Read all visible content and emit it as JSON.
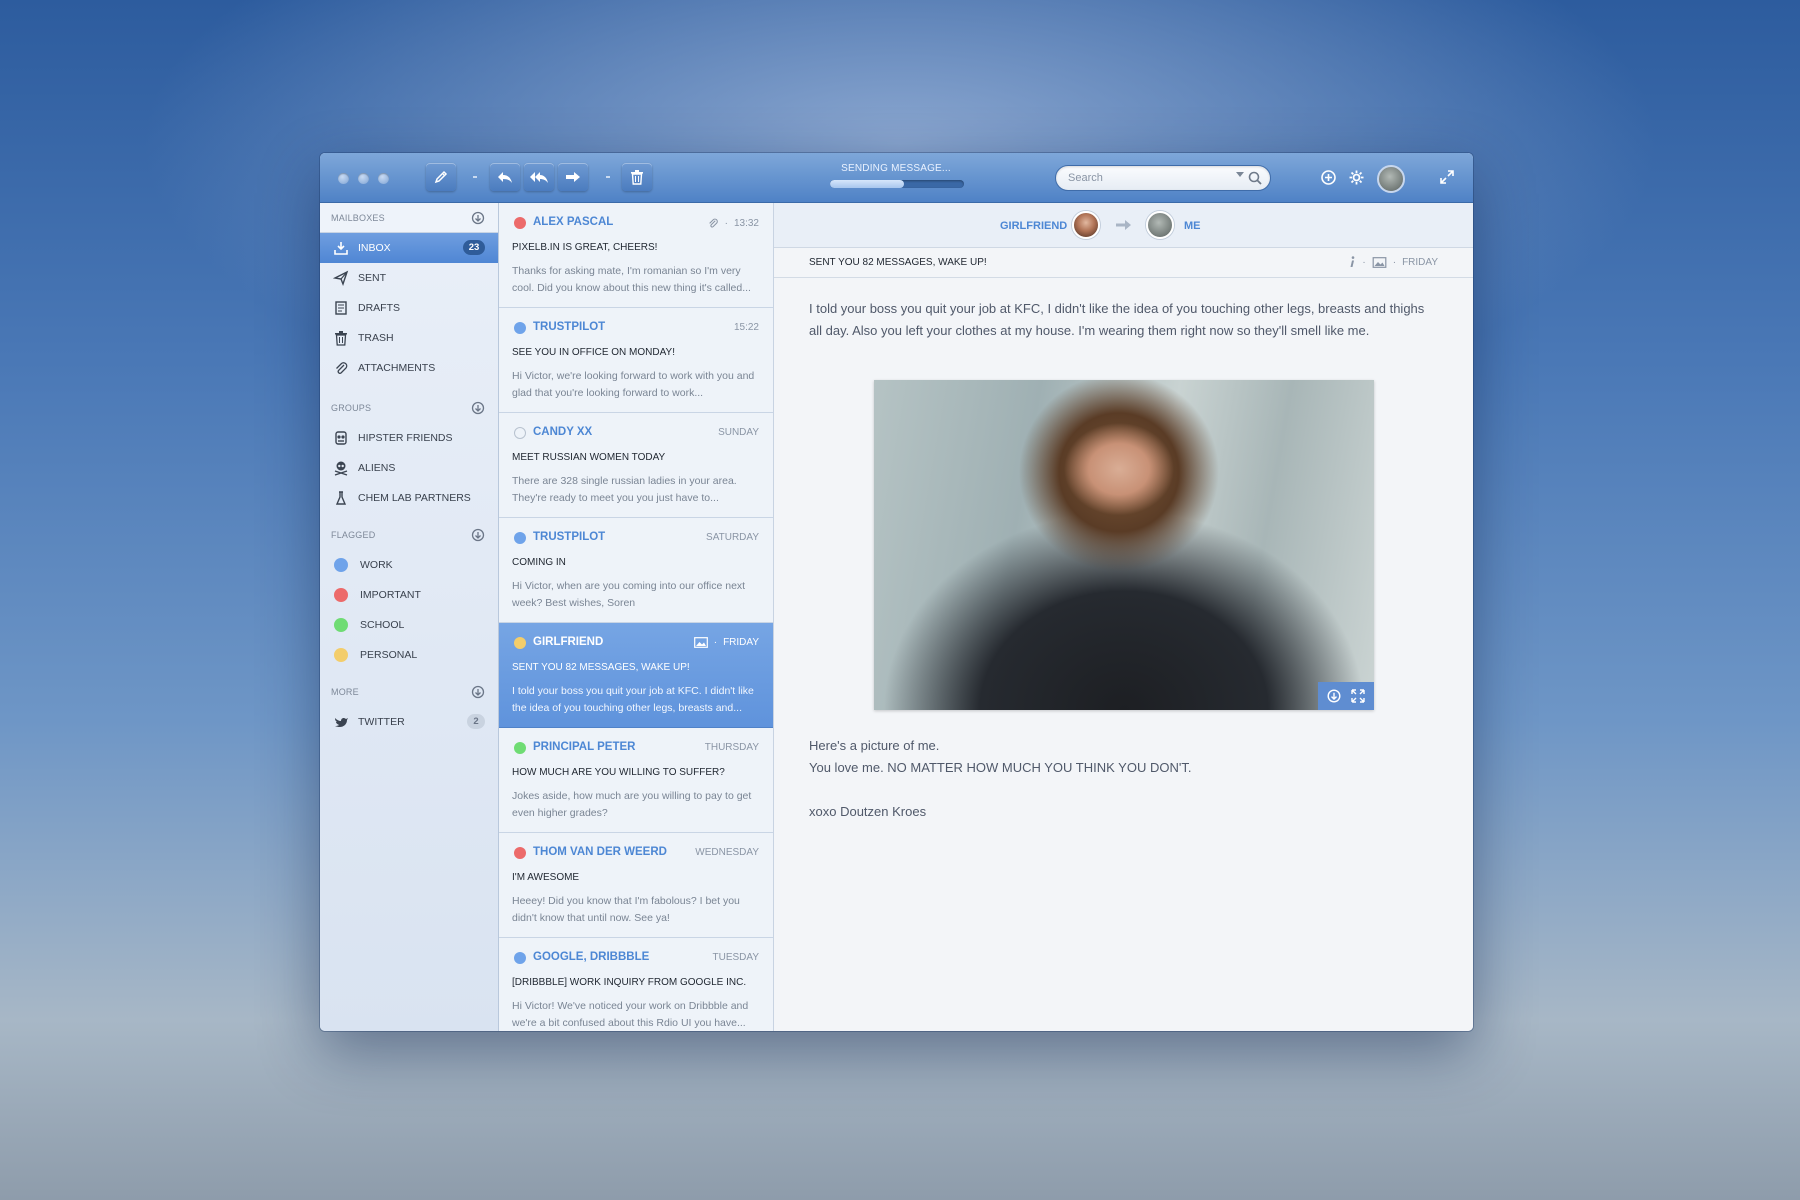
{
  "toolbar": {
    "status": "SENDING MESSAGE...",
    "progress": 0.55,
    "search_placeholder": "Search"
  },
  "sidebar": {
    "mailboxes_label": "MAILBOXES",
    "mailboxes": [
      {
        "label": "INBOX",
        "icon": "inbox-icon",
        "badge": "23",
        "active": true
      },
      {
        "label": "SENT",
        "icon": "paper-plane-icon"
      },
      {
        "label": "DRAFTS",
        "icon": "drafts-icon"
      },
      {
        "label": "TRASH",
        "icon": "trash-icon"
      },
      {
        "label": "ATTACHMENTS",
        "icon": "paperclip-icon"
      }
    ],
    "groups_label": "GROUPS",
    "groups": [
      {
        "label": "HIPSTER FRIENDS",
        "icon": "hipster-icon"
      },
      {
        "label": "ALIENS",
        "icon": "skull-icon"
      },
      {
        "label": "CHEM LAB PARTNERS",
        "icon": "flask-icon"
      }
    ],
    "flagged_label": "FLAGGED",
    "flagged": [
      {
        "label": "WORK",
        "color": "#6fa3ea"
      },
      {
        "label": "IMPORTANT",
        "color": "#ec6a6a"
      },
      {
        "label": "SCHOOL",
        "color": "#6fdc74"
      },
      {
        "label": "PERSONAL",
        "color": "#f3cd6b"
      }
    ],
    "more_label": "MORE",
    "more": [
      {
        "label": "TWITTER",
        "icon": "twitter-icon",
        "badge": "2"
      }
    ]
  },
  "messages": [
    {
      "sender": "ALEX PASCAL",
      "time": "13:32",
      "dot": "#ec6a6a",
      "attachment": true,
      "subject": "PIXELB.IN IS GREAT, CHEERS!",
      "preview": "Thanks for asking mate, I'm romanian so I'm very cool. Did you know about this new thing it's called..."
    },
    {
      "sender": "TRUSTPILOT",
      "time": "15:22",
      "dot": "#6fa3ea",
      "subject": "SEE YOU IN OFFICE ON MONDAY!",
      "preview": "Hi Victor, we're looking forward to work with you and glad that you're looking forward to work..."
    },
    {
      "sender": "CANDY XX",
      "time": "SUNDAY",
      "dot": "",
      "subject": "MEET RUSSIAN WOMEN TODAY",
      "preview": "There are 328 single russian ladies in your area. They're ready to meet you you just have to..."
    },
    {
      "sender": "TRUSTPILOT",
      "time": "SATURDAY",
      "dot": "#6fa3ea",
      "subject": "COMING IN",
      "preview": "Hi Victor, when are you coming into our office next week? Best wishes, Soren"
    },
    {
      "sender": "GIRLFRIEND",
      "time": "FRIDAY",
      "dot": "#f3cd6b",
      "image": true,
      "selected": true,
      "subject": "SENT YOU 82 MESSAGES, WAKE UP!",
      "preview": "I told your boss you quit your job at KFC. I didn't like the idea of you touching other legs, breasts and..."
    },
    {
      "sender": "PRINCIPAL PETER",
      "time": "THURSDAY",
      "dot": "#6fdc74",
      "subject": "HOW MUCH ARE YOU WILLING TO SUFFER?",
      "preview": "Jokes aside, how much are you willing to pay to get even higher grades?"
    },
    {
      "sender": "THOM VAN DER WEERD",
      "time": "WEDNESDAY",
      "dot": "#ec6a6a",
      "subject": "I'M AWESOME",
      "preview": "Heeey! Did you know that I'm fabolous? I bet you didn't know that until now. See ya!"
    },
    {
      "sender": "GOOGLE, DRIBBBLE",
      "time": "TUESDAY",
      "dot": "#6fa3ea",
      "subject": "[DRIBBBLE] WORK INQUIRY FROM GOOGLE INC.",
      "preview": "Hi Victor! We've noticed your work on Dribbble and we're a bit confused about this Rdio UI you have..."
    }
  ],
  "reader": {
    "from": "GIRLFRIEND",
    "to": "ME",
    "subject": "SENT YOU 82 MESSAGES, WAKE UP!",
    "day": "FRIDAY",
    "paragraph1": "I told your boss you quit your job at KFC, I didn't like the idea of you touching other legs, breasts and thighs all day. Also you left your clothes at my house. I'm wearing them right now so they'll smell like me.",
    "line2": "Here's a picture of me.",
    "line3": "You love me. NO MATTER HOW MUCH YOU THINK YOU DON'T.",
    "signature": "xoxo Doutzen Kroes"
  }
}
